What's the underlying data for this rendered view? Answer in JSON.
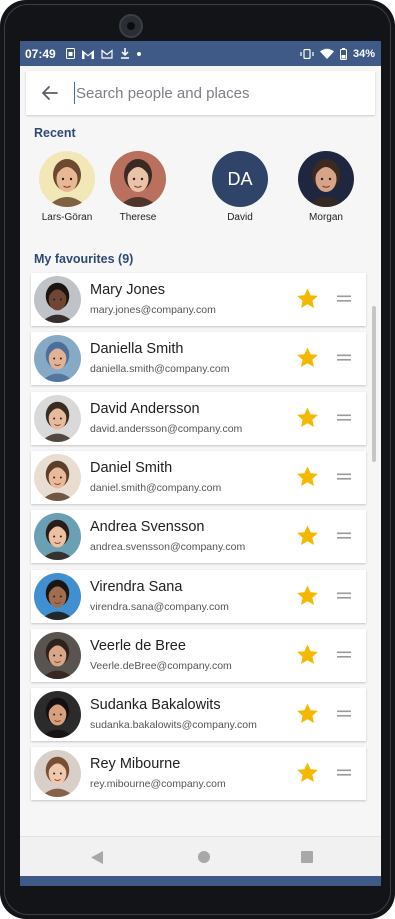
{
  "status_bar": {
    "time": "07:49",
    "battery": "34%",
    "icons": [
      "sim-icon",
      "gmail-icon",
      "gmail-outline-icon",
      "download-icon",
      "dot-icon",
      "vibrate-icon",
      "wifi-icon",
      "battery-icon"
    ]
  },
  "search": {
    "placeholder": "Search people and places",
    "value": ""
  },
  "recent": {
    "title": "Recent",
    "people": [
      {
        "name": "Lars-Göran",
        "skin": "#e8b894",
        "hair": "#6b4a30",
        "bg": "#f2e7b7",
        "initials": ""
      },
      {
        "name": "Therese",
        "skin": "#eac2a8",
        "hair": "#3a2a24",
        "bg": "#b9705c",
        "initials": ""
      },
      {
        "name": "David",
        "skin": "",
        "hair": "",
        "bg": "#2f4468",
        "initials": "DA"
      },
      {
        "name": "Morgan",
        "skin": "#d7a487",
        "hair": "#3b2a1e",
        "bg": "#1f2740",
        "initials": ""
      }
    ]
  },
  "favourites": {
    "title": "My favourites (9)",
    "people": [
      {
        "name": "Mary Jones",
        "email": "mary.jones@company.com",
        "skin": "#6e4631",
        "hair": "#1d1410",
        "bg": "#bfc3c7"
      },
      {
        "name": "Daniella Smith",
        "email": "daniella.smith@company.com",
        "skin": "#e1b296",
        "hair": "#4a6f9a",
        "bg": "#86a9c6"
      },
      {
        "name": "David Andersson",
        "email": "david.andersson@company.com",
        "skin": "#e6bb9d",
        "hair": "#3a2b22",
        "bg": "#d9d9d9"
      },
      {
        "name": "Daniel Smith",
        "email": "daniel.smith@company.com",
        "skin": "#e8b99a",
        "hair": "#5b3f2b",
        "bg": "#e8ddd0"
      },
      {
        "name": "Andrea Svensson",
        "email": "andrea.svensson@company.com",
        "skin": "#ecc0a0",
        "hair": "#2a1d17",
        "bg": "#6aa0b3"
      },
      {
        "name": "Virendra Sana",
        "email": "virendra.sana@company.com",
        "skin": "#a06d4f",
        "hair": "#1b1511",
        "bg": "#3f8fd1"
      },
      {
        "name": "Veerle de Bree",
        "email": "Veerle.deBree@company.com",
        "skin": "#d9a788",
        "hair": "#2f221a",
        "bg": "#59544f"
      },
      {
        "name": "Sudanka Bakalowits",
        "email": "sudanka.bakalowits@company.com",
        "skin": "#d7a07c",
        "hair": "#151010",
        "bg": "#2b2b2b"
      },
      {
        "name": "Rey Mibourne",
        "email": "rey.mibourne@company.com",
        "skin": "#efc8ae",
        "hair": "#7a4e33",
        "bg": "#d8d0c8"
      }
    ]
  },
  "colors": {
    "status_bar": "#3f5a86",
    "accent": "#2d4a74",
    "star": "#f5b800",
    "avatar_initials_bg": "#2f4468"
  }
}
